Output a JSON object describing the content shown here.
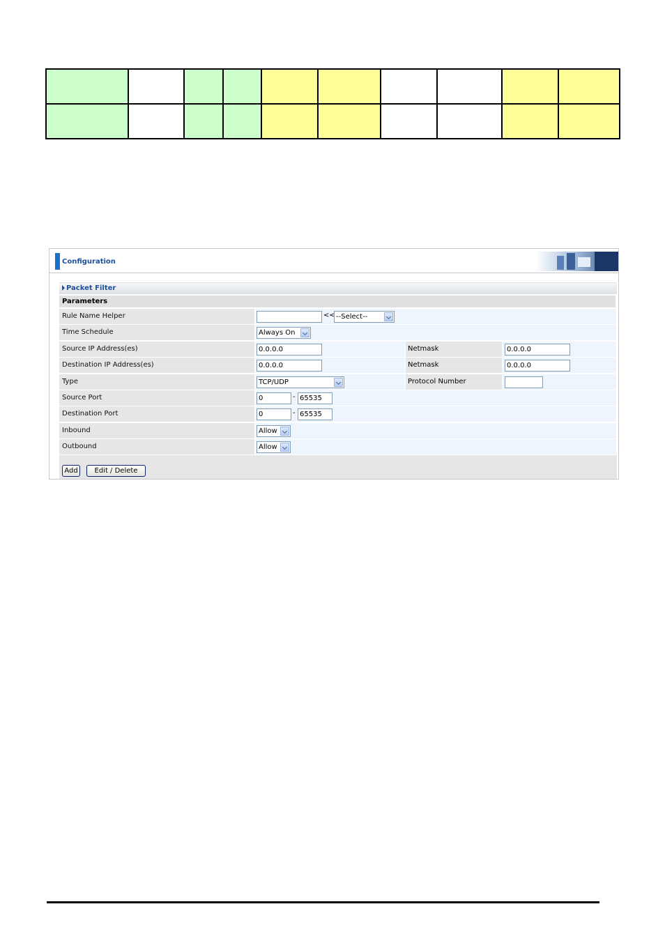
{
  "color_table": {
    "rows": [
      [
        "green",
        "white",
        "green",
        "green",
        "yellow",
        "yellow",
        "white",
        "white",
        "yellow",
        "yellow"
      ],
      [
        "green",
        "white",
        "green",
        "green",
        "yellow",
        "yellow",
        "white",
        "white",
        "yellow",
        "yellow"
      ]
    ],
    "colors": {
      "green": "#ccffcc",
      "white": "#ffffff",
      "yellow": "#ffff99"
    }
  },
  "header": {
    "title": "Configuration"
  },
  "section": {
    "title": "Packet Filter"
  },
  "params": {
    "heading": "Parameters",
    "rule_name": {
      "label": "Rule Name  Helper",
      "value": "",
      "arrows": "<<",
      "helper_select": "--Select--"
    },
    "time_schedule": {
      "label": "Time Schedule",
      "value": "Always On"
    },
    "source_ip": {
      "label": "Source IP Address(es)",
      "value": "0.0.0.0",
      "netmask_label": "Netmask",
      "netmask": "0.0.0.0"
    },
    "dest_ip": {
      "label": "Destination IP Address(es)",
      "value": "0.0.0.0",
      "netmask_label": "Netmask",
      "netmask": "0.0.0.0"
    },
    "type": {
      "label": "Type",
      "value": "TCP/UDP",
      "protocol_label": "Protocol Number",
      "protocol": ""
    },
    "source_port": {
      "label": "Source Port",
      "from": "0",
      "dash": "-",
      "to": "65535"
    },
    "dest_port": {
      "label": "Destination Port",
      "from": "0",
      "dash": "-",
      "to": "65535"
    },
    "inbound": {
      "label": "Inbound",
      "value": "Allow"
    },
    "outbound": {
      "label": "Outbound",
      "value": "Allow"
    }
  },
  "actions": {
    "add": "Add",
    "edit_delete": "Edit / Delete"
  },
  "accent": "#1a73c9"
}
